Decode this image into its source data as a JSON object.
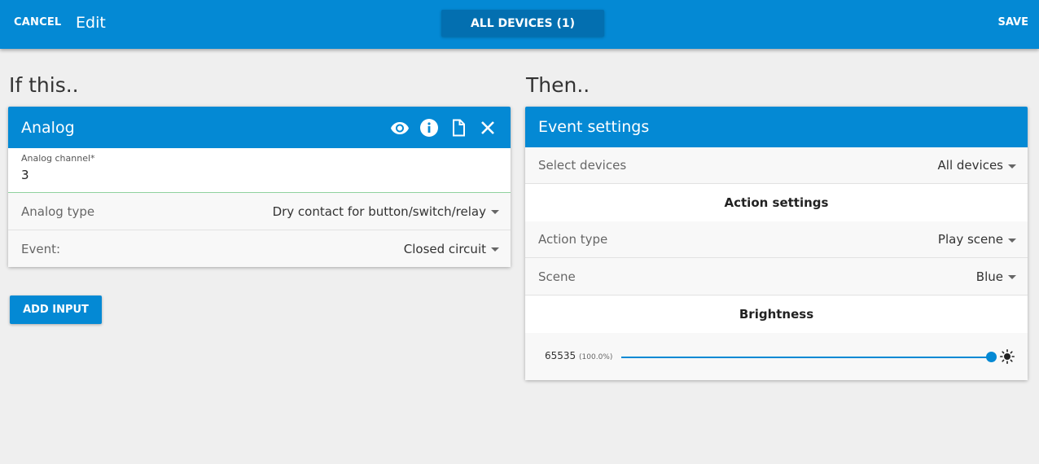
{
  "topbar": {
    "cancel_label": "CANCEL",
    "title": "Edit",
    "devices_label": "ALL DEVICES (1)",
    "save_label": "SAVE"
  },
  "if_section": {
    "title": "If this..",
    "card": {
      "title": "Analog",
      "icons": [
        "eye-icon",
        "info-icon",
        "copy-icon",
        "close-icon"
      ],
      "channel_label": "Analog channel*",
      "channel_value": "3",
      "analog_type_label": "Analog type",
      "analog_type_value": "Dry contact for button/switch/relay",
      "event_label": "Event:",
      "event_value": "Closed circuit"
    },
    "add_input_label": "ADD INPUT"
  },
  "then_section": {
    "title": "Then..",
    "card": {
      "title": "Event settings",
      "select_devices_label": "Select devices",
      "select_devices_value": "All devices",
      "action_settings_heading": "Action settings",
      "action_type_label": "Action type",
      "action_type_value": "Play scene",
      "scene_label": "Scene",
      "scene_value": "Blue",
      "brightness_heading": "Brightness",
      "brightness_value": "65535",
      "brightness_percent": "(100.0%)",
      "brightness_fraction": 1.0
    }
  },
  "colors": {
    "accent": "#0489d4",
    "accent_dark": "#036fb0",
    "background": "#efefef"
  }
}
